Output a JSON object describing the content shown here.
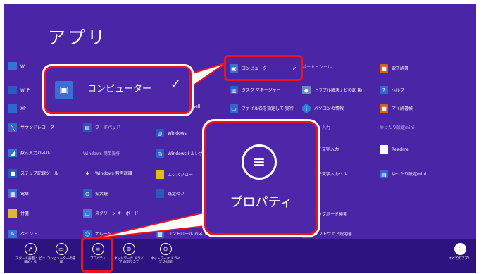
{
  "screen": {
    "title": "アプリ",
    "accent": "#4a26a6",
    "appbar_color": "#2d1380",
    "highlight_color": "#e8141f"
  },
  "tiles": [
    {
      "label": "Wi",
      "icon": "app-icon",
      "color": "#3b6fd1"
    },
    {
      "label": "Wi Pi",
      "icon": "app-icon",
      "color": "#2e59c0"
    },
    {
      "label": "XP",
      "icon": "app-icon",
      "color": "#2f66d0"
    },
    {
      "label": "サウンドレコーダー",
      "icon": "mic-icon",
      "color": "#3367c9"
    },
    {
      "label": "数式入力パネル",
      "icon": "math-input-icon",
      "color": "#3a72cf"
    },
    {
      "label": "ステップ記録ツール",
      "icon": "step-recorder-icon",
      "color": "#2c58b8"
    },
    {
      "label": "電卓",
      "icon": "calculator-icon",
      "color": "#3b6fd1"
    },
    {
      "label": "付箋",
      "icon": "sticky-notes-icon",
      "color": "#e0b928"
    },
    {
      "label": "ペイント",
      "icon": "paint-icon",
      "color": "#3b6fd1"
    },
    {
      "label": "ワードパッド",
      "icon": "wordpad-icon",
      "color": "#2c58b8"
    },
    {
      "label": "Windows 音声認識",
      "icon": "mic-icon",
      "color": "#4a26a6"
    },
    {
      "label": "拡大鏡",
      "icon": "magnifier-icon",
      "color": "#2e59c0"
    },
    {
      "label": "スクリーン キーボード",
      "icon": "keyboard-icon",
      "color": "#3d7bd5"
    },
    {
      "label": "ナレーター",
      "icon": "narrator-icon",
      "color": "#2d5fc2"
    },
    {
      "label": "Windows",
      "icon": "powershell-icon",
      "color": "#2b57b8"
    },
    {
      "label": "Windows I ルレポート",
      "icon": "powershell-icon",
      "color": "#2d5fc2"
    },
    {
      "label": "エクスプロー",
      "icon": "folder-icon",
      "color": "#e0b928"
    },
    {
      "label": "既定のプ",
      "icon": "app-icon",
      "color": "#2c58b8"
    },
    {
      "label": "コントロール パネル",
      "icon": "control-panel-icon",
      "color": "#3367c9"
    },
    {
      "label": "タスク マネージャー",
      "icon": "task-manager-icon",
      "color": "#2d5fc2"
    },
    {
      "label": "ファイル名を指定して 実行",
      "icon": "run-icon",
      "color": "#3367c9"
    },
    {
      "label": "ershell",
      "icon": "powershell-icon",
      "color": "#2b57b8"
    },
    {
      "label": "トラブル解決ナビの起 動",
      "icon": "troubleshoot-icon",
      "color": "#6b8cc2"
    },
    {
      "label": "パソコンの情報",
      "icon": "info-icon",
      "color": "#2a7fd8"
    },
    {
      "label": "チ文字入力",
      "icon": "app-icon",
      "color": "#4a26a6"
    },
    {
      "label": "チ文字入力ヘル",
      "icon": "app-icon",
      "color": "#4a26a6"
    },
    {
      "label": "ップボード検索",
      "icon": "app-icon",
      "color": "#4a26a6"
    },
    {
      "label": "ソフトウェア説明書",
      "icon": "manual-icon",
      "color": "#3367c9"
    },
    {
      "label": "電子辞書",
      "icon": "dictionary-icon",
      "color": "#d75f1e"
    },
    {
      "label": "ヘルプ",
      "icon": "help-icon",
      "color": "#3367c9"
    },
    {
      "label": "マイ辞書帳",
      "icon": "dictionary-icon",
      "color": "#d75f1e"
    },
    {
      "label": "Readme",
      "icon": "document-icon",
      "color": "#ffffff"
    },
    {
      "label": "ゆったり設定mini",
      "icon": "settings-mini-icon",
      "color": "#3367c9"
    }
  ],
  "headers": [
    {
      "label": "Windows 簡単操作"
    },
    {
      "label": "ポート・ツール"
    },
    {
      "label": "入力"
    },
    {
      "label": "ゆったり設定mini"
    }
  ],
  "computer_tile": {
    "label": "コンピューター",
    "check": "✓"
  },
  "callout_computer": {
    "label": "コンピューター",
    "check": "✓"
  },
  "callout_properties": {
    "label": "プロパティ"
  },
  "appbar": [
    {
      "label": "スタート画面に ピン留めする",
      "icon": "pin-icon"
    },
    {
      "label": "コンピューターの管 理",
      "icon": "computer-manage-icon"
    },
    {
      "label": "プロパティ",
      "icon": "properties-icon"
    },
    {
      "label": "ネットワーク ドライブ の割り当て",
      "icon": "map-drive-icon"
    },
    {
      "label": "ネットワーク ドライブ の切断",
      "icon": "disconnect-drive-icon"
    },
    {
      "label": "すべてのアプリ",
      "icon": "all-apps-icon"
    }
  ]
}
